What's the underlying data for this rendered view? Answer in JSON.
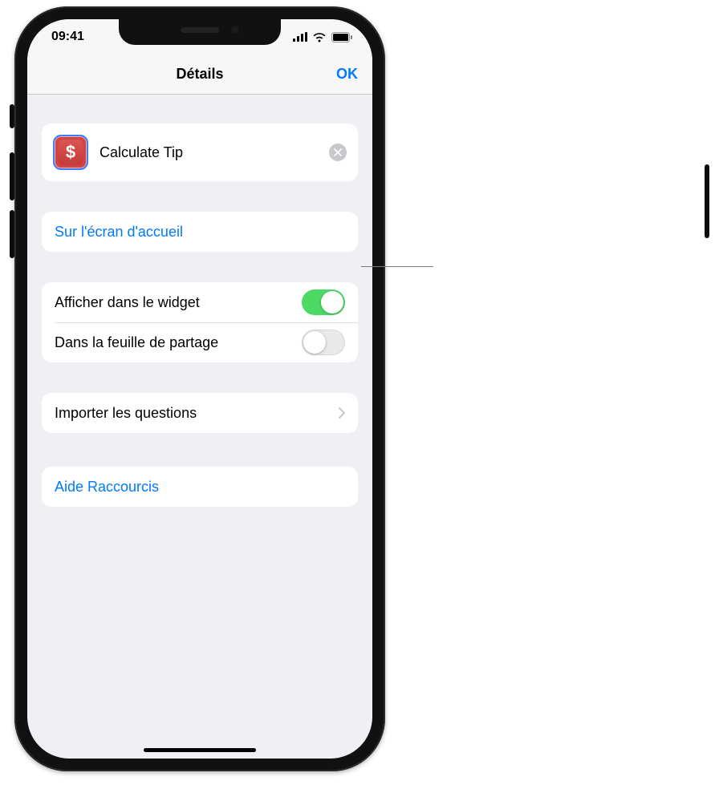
{
  "statusbar": {
    "time": "09:41"
  },
  "navbar": {
    "title": "Détails",
    "done": "OK"
  },
  "shortcut": {
    "name": "Calculate Tip",
    "glyph": "$",
    "icon_name": "dollar-icon"
  },
  "rows": {
    "add_home": "Sur l'écran d'accueil",
    "show_widget": "Afficher dans le widget",
    "share_sheet": "Dans la feuille de partage",
    "import_q": "Importer les questions",
    "help": "Aide Raccourcis"
  },
  "toggles": {
    "show_widget": true,
    "share_sheet": false
  }
}
